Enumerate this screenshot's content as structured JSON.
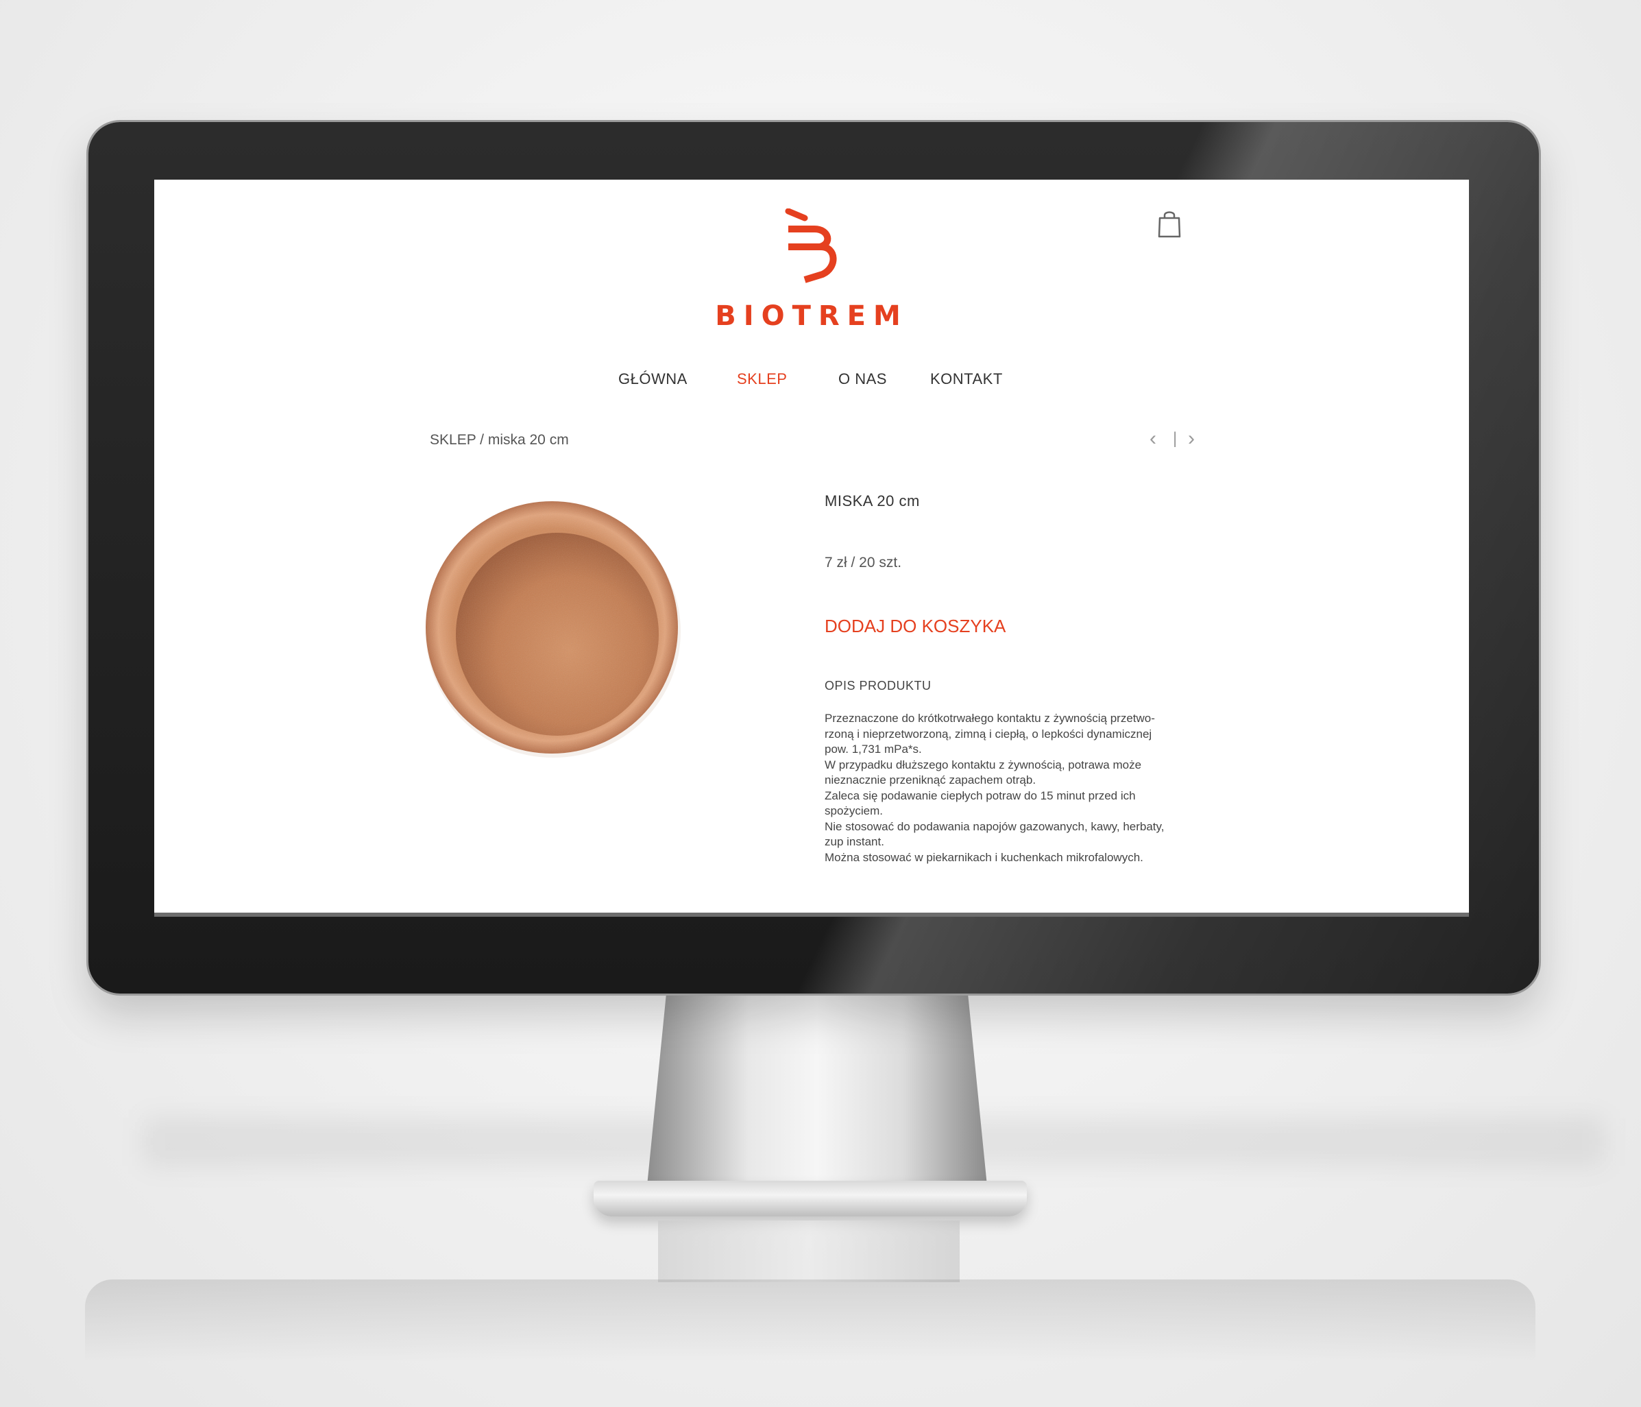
{
  "site": {
    "brand_name": "BIOTREM",
    "accent_color": "#e5401f"
  },
  "header": {
    "cart_icon": "shopping-bag-icon"
  },
  "nav": {
    "items": [
      {
        "label": "GŁÓWNA",
        "active": false
      },
      {
        "label": "SKLEP",
        "active": true
      },
      {
        "label": "O NAS",
        "active": false
      },
      {
        "label": "KONTAKT",
        "active": false
      }
    ]
  },
  "breadcrumb": "SKLEP / miska 20 cm",
  "pager": {
    "prev_icon": "chevron-left-icon",
    "separator": "|",
    "next_icon": "chevron-right-icon"
  },
  "product": {
    "title": "MISKA 20 cm",
    "price": "7 zł / 20 szt.",
    "add_to_cart": "DODAJ DO KOSZYKA",
    "description_heading": "OPIS PRODUKTU",
    "description_lines": [
      "Przeznaczone do krótkotrwałego kontaktu z żywnością przetwo-",
      "rzoną i nieprzetworzoną, zimną i ciepłą, o lepkości dynamicznej",
      "pow. 1,731 mPa*s.",
      "W przypadku dłuższego kontaktu z żywnością, potrawa może",
      "nieznacznie przeniknąć zapachem otrąb.",
      "Zaleca się podawanie ciepłych potraw do 15 minut przed ich",
      "spożyciem.",
      "Nie stosować do podawania napojów gazowanych, kawy, herbaty,",
      "zup instant.",
      "Można stosować w piekarnikach i kuchenkach mikrofalowych."
    ]
  }
}
